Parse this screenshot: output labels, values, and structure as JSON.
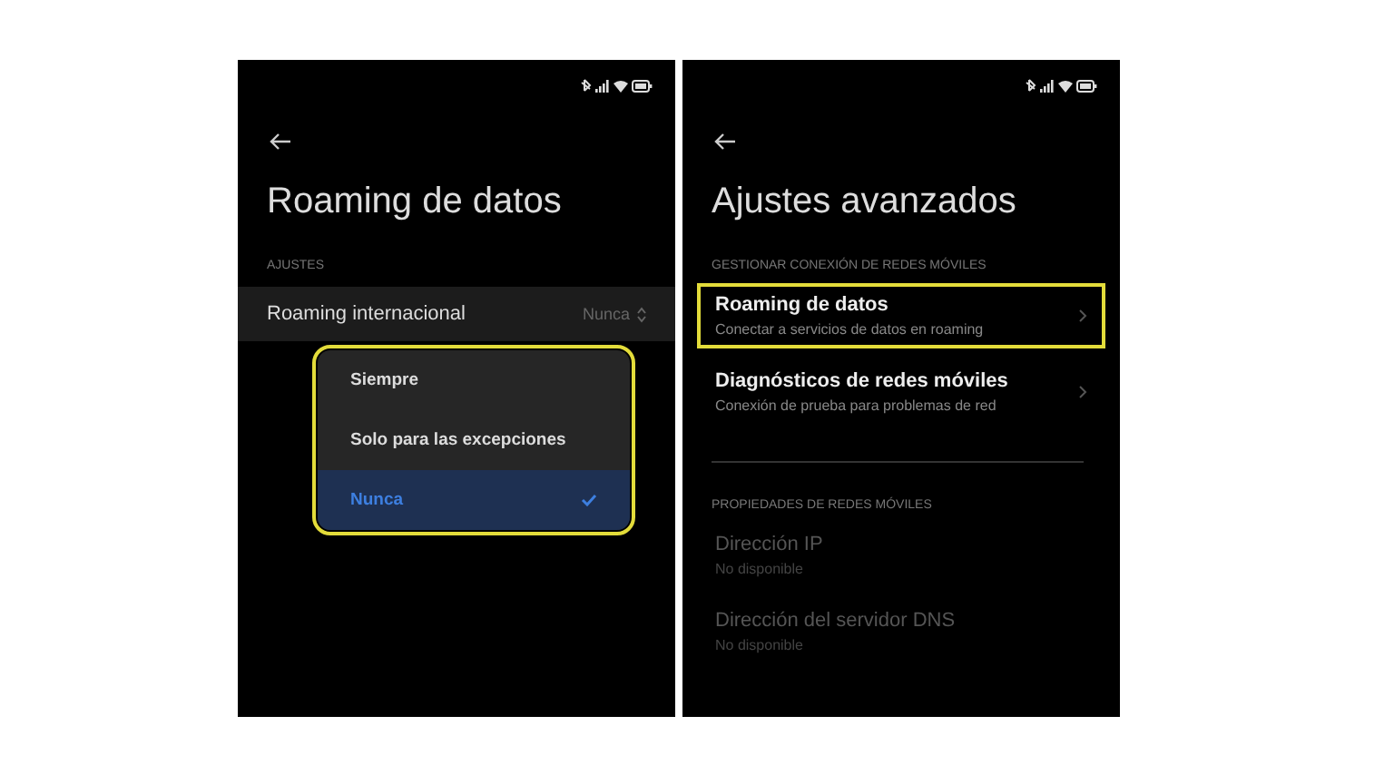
{
  "left_screen": {
    "title": "Roaming de datos",
    "section": "AJUSTES",
    "setting": {
      "label": "Roaming internacional",
      "value": "Nunca"
    },
    "menu": {
      "highlighted": true,
      "options": [
        {
          "label": "Siempre",
          "selected": false
        },
        {
          "label": "Solo para las excepciones",
          "selected": false
        },
        {
          "label": "Nunca",
          "selected": true
        }
      ]
    }
  },
  "right_screen": {
    "title": "Ajustes avanzados",
    "sections": [
      {
        "header": "GESTIONAR CONEXIÓN DE REDES MÓVILES",
        "items": [
          {
            "title": "Roaming de datos",
            "subtitle": "Conectar a servicios de datos en roaming",
            "highlighted": true,
            "disabled": false,
            "chevron": true
          },
          {
            "title": "Diagnósticos de redes móviles",
            "subtitle": "Conexión de prueba para problemas de red",
            "highlighted": false,
            "disabled": false,
            "chevron": true
          }
        ]
      },
      {
        "header": "PROPIEDADES DE REDES MÓVILES",
        "items": [
          {
            "title": "Dirección IP",
            "subtitle": "No disponible",
            "highlighted": false,
            "disabled": true,
            "chevron": false
          },
          {
            "title": "Dirección del servidor DNS",
            "subtitle": "No disponible",
            "highlighted": false,
            "disabled": true,
            "chevron": false
          }
        ]
      }
    ]
  }
}
